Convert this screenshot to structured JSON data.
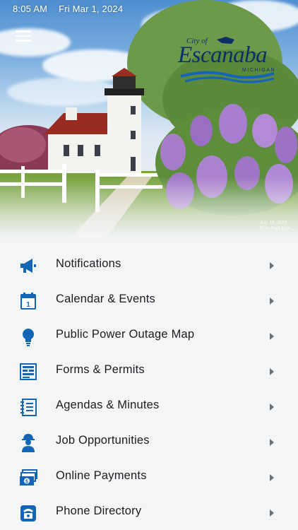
{
  "status_bar": {
    "time": "8:05 AM",
    "date": "Fri Mar 1, 2024"
  },
  "logo": {
    "city_of": "City of",
    "name": "Escanaba",
    "state": "MICHIGAN"
  },
  "photo_credit": {
    "line1": "July 18, 2019",
    "line2": "© by Paul Lam..."
  },
  "colors": {
    "accent": "#1565b5",
    "background": "#f4f5f7",
    "text": "#1d1d1f",
    "chevron": "#6b6f75"
  },
  "menu": [
    {
      "label": "Notifications",
      "icon": "megaphone-icon"
    },
    {
      "label": "Calendar & Events",
      "icon": "calendar-icon"
    },
    {
      "label": "Public Power Outage Map",
      "icon": "lightbulb-icon"
    },
    {
      "label": "Forms & Permits",
      "icon": "forms-icon"
    },
    {
      "label": "Agendas & Minutes",
      "icon": "notebook-icon"
    },
    {
      "label": "Job Opportunities",
      "icon": "worker-icon"
    },
    {
      "label": "Online Payments",
      "icon": "money-icon"
    },
    {
      "label": "Phone Directory",
      "icon": "phone-icon"
    }
  ]
}
